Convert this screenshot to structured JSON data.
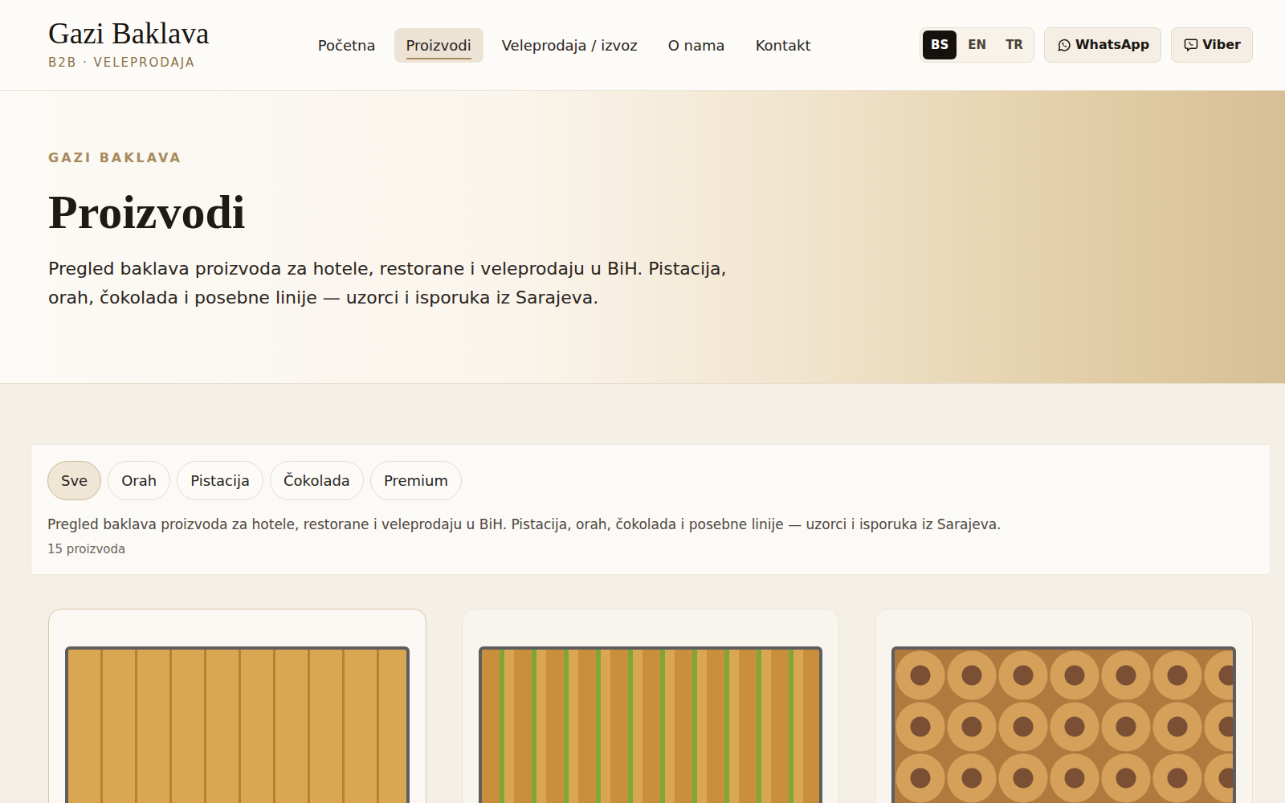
{
  "header": {
    "logo": {
      "title": "Gazi Baklava",
      "subtitle": "B2B · VELEPRODAJA"
    },
    "nav": [
      {
        "label": "Početna",
        "selected": false
      },
      {
        "label": "Proizvodi",
        "selected": true
      },
      {
        "label": "Veleprodaja / izvoz",
        "selected": false
      },
      {
        "label": "O nama",
        "selected": false
      },
      {
        "label": "Kontakt",
        "selected": false
      }
    ],
    "languages": [
      {
        "label": "BS",
        "selected": true
      },
      {
        "label": "EN",
        "selected": false
      },
      {
        "label": "TR",
        "selected": false
      }
    ],
    "buttons": [
      {
        "label": "WhatsApp",
        "kind": "whatsapp"
      },
      {
        "label": "Viber",
        "kind": "viber"
      }
    ]
  },
  "hero": {
    "eyebrow": "GAZI BAKLAVA",
    "title": "Proizvodi",
    "lead": "Pregled baklava proizvoda za hotele, restorane i veleprodaju u BiH. Pistacija, orah, čokolada i posebne linije — uzorci i isporuka iz Sarajeva."
  },
  "filters": {
    "chips": [
      {
        "label": "Sve",
        "selected": true
      },
      {
        "label": "Orah",
        "selected": false
      },
      {
        "label": "Pistacija",
        "selected": false
      },
      {
        "label": "Čokolada",
        "selected": false
      },
      {
        "label": "Premium",
        "selected": false
      }
    ],
    "description": "Pregled baklava proizvoda za hotele, restorane i veleprodaju u BiH. Pistacija, orah, čokolada i posebne linije — uzorci i isporuka iz Sarajeva.",
    "count": "15 proizvoda"
  },
  "products": [
    {
      "highlighted": true
    },
    {
      "highlighted": false
    },
    {
      "highlighted": false
    }
  ]
}
